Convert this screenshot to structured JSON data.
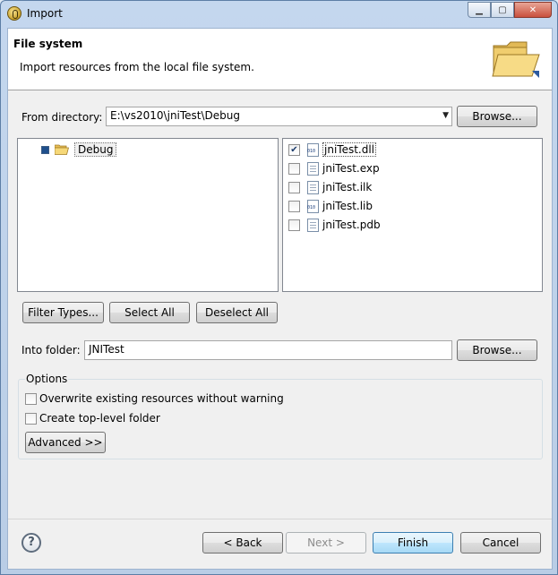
{
  "window": {
    "title": "Import"
  },
  "header": {
    "title": "File system",
    "description": "Import resources from the local file system.",
    "icon": "folder-icon"
  },
  "source": {
    "from_directory_label": "From directory:",
    "from_directory_value": "E:\\vs2010\\jniTest\\Debug",
    "browse_label": "Browse..."
  },
  "tree": {
    "items": [
      {
        "label": "Debug",
        "icon": "folder-open-icon",
        "checked": "partial"
      }
    ]
  },
  "files": [
    {
      "label": "jniTest.dll",
      "checked": true,
      "icon": "binary-file-icon"
    },
    {
      "label": "jniTest.exp",
      "checked": false,
      "icon": "text-file-icon"
    },
    {
      "label": "jniTest.ilk",
      "checked": false,
      "icon": "text-file-icon"
    },
    {
      "label": "jniTest.lib",
      "checked": false,
      "icon": "binary-file-icon"
    },
    {
      "label": "jniTest.pdb",
      "checked": false,
      "icon": "text-file-icon"
    }
  ],
  "selection_buttons": {
    "filter_types": "Filter Types...",
    "select_all": "Select All",
    "deselect_all": "Deselect All"
  },
  "destination": {
    "into_folder_label": "Into folder:",
    "into_folder_value": "JNITest",
    "browse_label": "Browse..."
  },
  "options": {
    "title": "Options",
    "overwrite_label": "Overwrite existing resources without warning",
    "overwrite_checked": false,
    "top_level_label": "Create top-level folder",
    "top_level_checked": false,
    "advanced_label": "Advanced >>"
  },
  "footer": {
    "back": "< Back",
    "next": "Next >",
    "finish": "Finish",
    "cancel": "Cancel"
  },
  "colors": {
    "accent": "#3c7fb1",
    "frame": "#c4d7ee"
  }
}
